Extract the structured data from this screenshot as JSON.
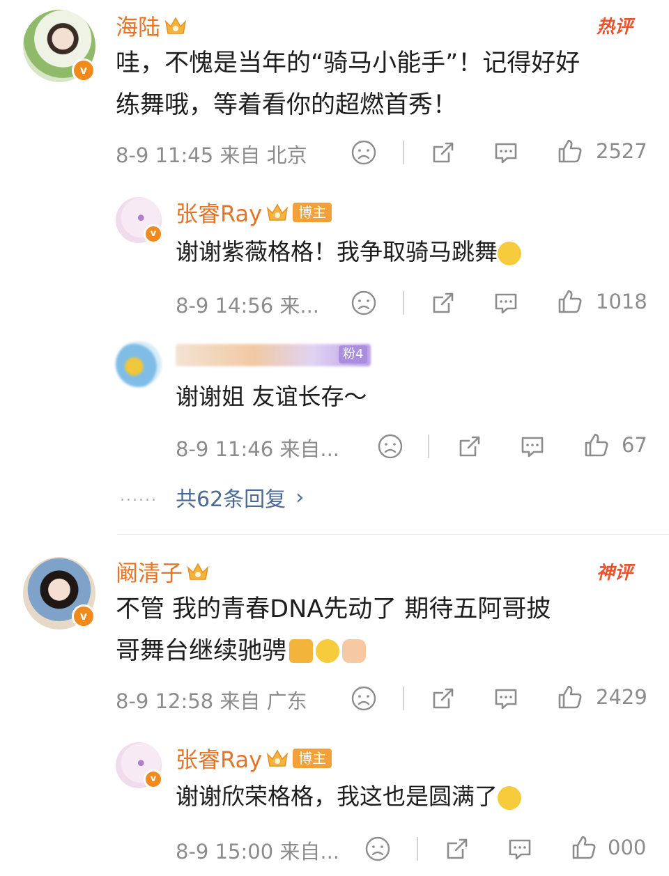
{
  "comments": [
    {
      "user": "海陆",
      "badge": "热评",
      "text_lines": [
        "哇，不愧是当年的“骑马小能手”！记得好好",
        "练舞哦，等着看你的超燃首秀！"
      ],
      "meta": "8-9 11:45  来自 北京",
      "likes": "2527",
      "replies": [
        {
          "user": "张睿Ray",
          "tag": "博主",
          "text": "谢谢紫薇格格！我争取骑马跳舞",
          "meta": "8-9 14:56  来...",
          "likes": "1018"
        },
        {
          "user": "",
          "tag": "粉4",
          "text": "谢谢姐 友谊长存～",
          "meta": "8-9 11:46  来自...",
          "likes": "67"
        }
      ],
      "more_replies": "共62条回复",
      "more_dots": "......"
    },
    {
      "user": "阚清子",
      "badge": "神评",
      "text_lines": [
        "不管  我的青春DNA先动了  期待五阿哥披",
        "哥舞台继续驰骋"
      ],
      "meta": "8-9 12:58  来自 广东",
      "likes": "2429",
      "replies": [
        {
          "user": "张睿Ray",
          "tag": "博主",
          "text": "谢谢欣荣格格，我这也是圆满了",
          "meta": "8-9 15:00  来自...",
          "likes": "000"
        }
      ]
    }
  ],
  "icons": [
    "angry-face-icon",
    "share-icon",
    "comment-icon",
    "like-thumb-icon",
    "crown-icon",
    "smile-emoji-icon"
  ],
  "colors": {
    "name": "#e57426",
    "accent_red": "#e7542f",
    "meta": "#8c8c8c",
    "link": "#4a6a95",
    "vip": "#f08a1d"
  }
}
